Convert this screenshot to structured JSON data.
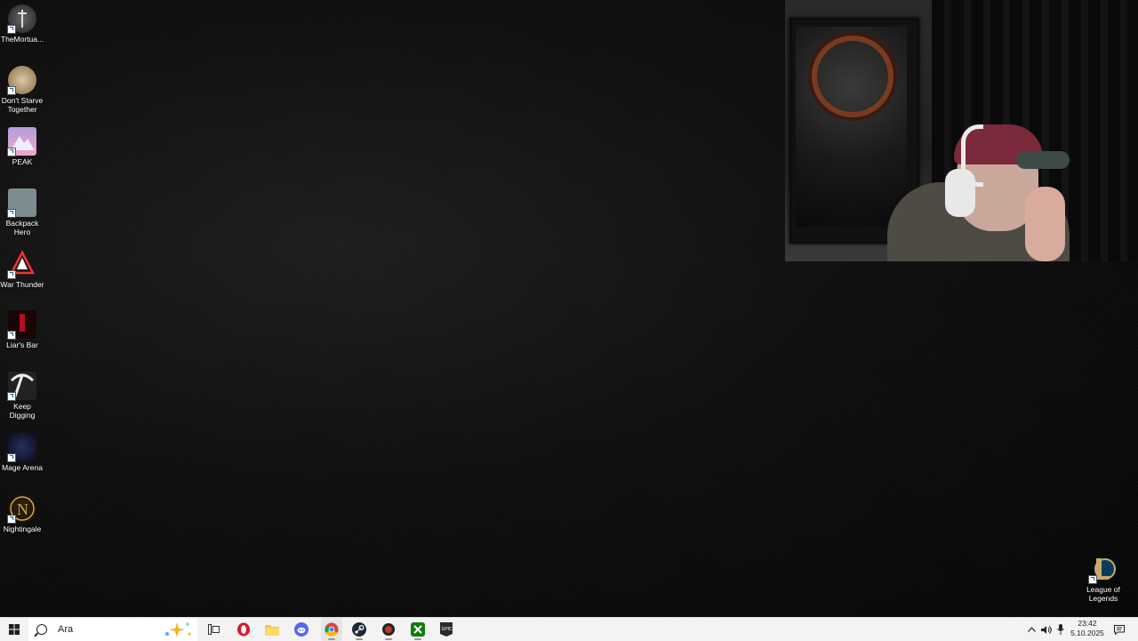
{
  "desktop": {
    "icons": [
      {
        "label": "TheMortua...",
        "icon": "the-mortuary-icon"
      },
      {
        "label": "Don't Starve Together",
        "icon": "dont-starve-together-icon"
      },
      {
        "label": "PEAK",
        "icon": "peak-icon"
      },
      {
        "label": "Backpack Hero",
        "icon": "backpack-hero-icon"
      },
      {
        "label": "War Thunder",
        "icon": "war-thunder-icon"
      },
      {
        "label": "Liar's Bar",
        "icon": "liars-bar-icon"
      },
      {
        "label": "Keep Digging",
        "icon": "keep-digging-icon"
      },
      {
        "label": "Mage Arena",
        "icon": "mage-arena-icon"
      },
      {
        "label": "Nightingale",
        "icon": "nightingale-icon"
      }
    ],
    "right_icon": {
      "label": "League of Legends",
      "icon": "league-of-legends-icon"
    }
  },
  "taskbar": {
    "search_text": "Ara",
    "apps": [
      {
        "name": "task-view",
        "icon": "task-view-icon",
        "color": "#333333"
      },
      {
        "name": "opera",
        "icon": "opera-icon",
        "color": "#e0122a"
      },
      {
        "name": "file-explorer",
        "icon": "folder-icon",
        "color": "#f4c542"
      },
      {
        "name": "discord",
        "icon": "discord-icon",
        "color": "#5865f2"
      },
      {
        "name": "chrome",
        "icon": "chrome-icon",
        "color": "#4285f4"
      },
      {
        "name": "steam",
        "icon": "steam-icon",
        "color": "#1b2838"
      },
      {
        "name": "app-red",
        "icon": "red-app-icon",
        "color": "#c0392b"
      },
      {
        "name": "xbox",
        "icon": "xbox-icon",
        "color": "#107c10"
      },
      {
        "name": "epic-games",
        "icon": "epic-games-icon",
        "color": "#2a2a2a"
      }
    ],
    "clock": {
      "time": "23:42",
      "date": "5.10.2025"
    }
  }
}
